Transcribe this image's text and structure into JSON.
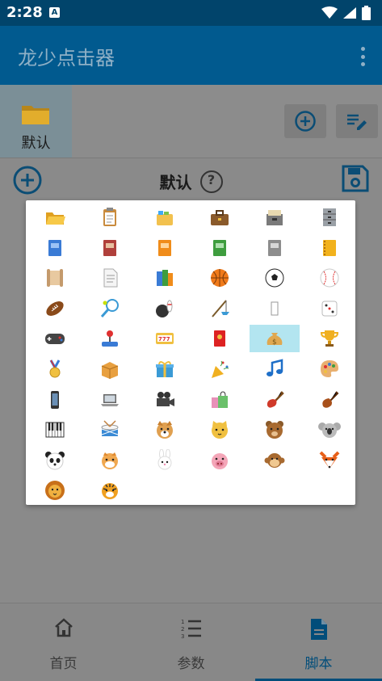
{
  "status": {
    "time": "2:28",
    "notif": "A"
  },
  "appbar": {
    "title": "龙少点击器"
  },
  "folder_tab": {
    "label": "默认"
  },
  "header": {
    "title": "默认",
    "help": "?"
  },
  "nav": [
    {
      "label": "首页",
      "icon": "home-icon"
    },
    {
      "label": "参数",
      "icon": "list-numbered-icon"
    },
    {
      "label": "脚本",
      "icon": "document-icon",
      "active": true
    }
  ],
  "colors": {
    "status_bg": "#01446b",
    "appbar_bg": "#015a8f",
    "accent": "#014d7a",
    "selected_bg": "#b3e5f0"
  },
  "emoji_picker": {
    "selected_index": 28,
    "items": [
      "open-folder-icon",
      "clipboard-icon",
      "card-index-dividers-icon",
      "briefcase-icon",
      "card-file-box-icon",
      "file-cabinet-icon",
      "blue-book-icon",
      "notebook-decorative-icon",
      "orange-book-icon",
      "green-book-icon",
      "closed-book-icon",
      "ledger-icon",
      "scroll-icon",
      "page-facing-up-icon",
      "books-icon",
      "basketball-icon",
      "soccer-ball-icon",
      "baseball-icon",
      "american-football-icon",
      "badminton-icon",
      "bowling-icon",
      "fishing-pole-icon",
      "unknown-glyph-icon",
      "game-die-icon",
      "video-game-icon",
      "joystick-icon",
      "slot-machine-icon",
      "red-envelope-icon",
      "money-bag-icon",
      "trophy-icon",
      "sports-medal-icon",
      "package-icon",
      "wrapped-gift-icon",
      "party-popper-icon",
      "musical-note-icon",
      "artist-palette-icon",
      "mobile-phone-icon",
      "laptop-icon",
      "movie-camera-icon",
      "shopping-bags-icon",
      "guitar-icon",
      "violin-icon",
      "piano-keys-icon",
      "drum-icon",
      "dog-face-icon",
      "cat-face-icon",
      "bear-face-icon",
      "koala-icon",
      "panda-face-icon",
      "hamster-face-icon",
      "rabbit-face-icon",
      "pig-face-icon",
      "monkey-face-icon",
      "fox-face-icon",
      "lion-face-icon",
      "tiger-face-icon"
    ]
  }
}
